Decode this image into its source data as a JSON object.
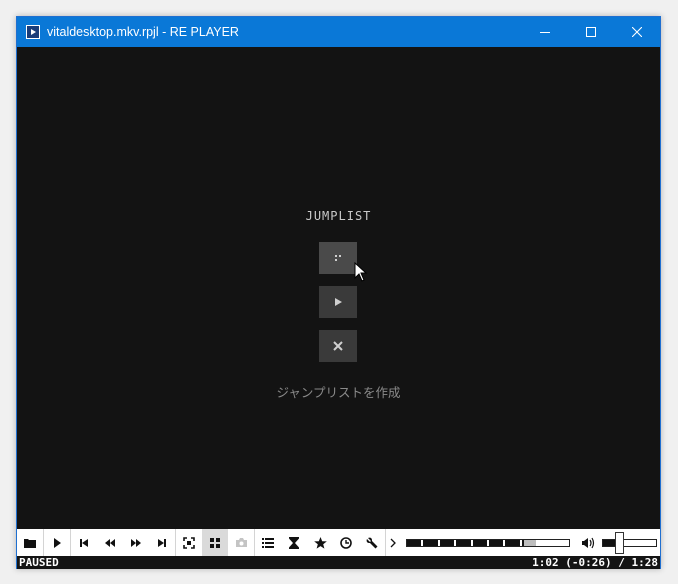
{
  "window": {
    "title": "vitaldesktop.mkv.rpjl - RE PLAYER"
  },
  "jumplist": {
    "title": "JUMPLIST",
    "caption": "ジャンプリストを作成"
  },
  "controls": {
    "buttons": [
      {
        "name": "open-folder-icon",
        "active": false
      },
      {
        "name": "play-icon",
        "active": false
      },
      {
        "name": "skip-previous-icon",
        "active": false
      },
      {
        "name": "rewind-icon",
        "active": false
      },
      {
        "name": "fast-forward-icon",
        "active": false
      },
      {
        "name": "skip-next-icon",
        "active": false
      },
      {
        "name": "fit-screen-icon",
        "active": false
      },
      {
        "name": "grid-icon",
        "active": true
      },
      {
        "name": "camera-icon",
        "active": false
      },
      {
        "name": "list-icon",
        "active": false
      },
      {
        "name": "hourglass-icon",
        "active": false
      },
      {
        "name": "star-icon",
        "active": false
      },
      {
        "name": "clock-icon",
        "active": false
      },
      {
        "name": "wrench-icon",
        "active": false
      },
      {
        "name": "chevron-right-icon",
        "active": false
      }
    ],
    "seek_progress": 0.72,
    "seek_buffered": 0.8,
    "volume": 0.3
  },
  "status": {
    "state": "PAUSED",
    "time": "1:02 (-0:26) / 1:28"
  },
  "colors": {
    "titlebar": "#0a78d7",
    "background": "#131313",
    "button": "#3a3a3a"
  }
}
